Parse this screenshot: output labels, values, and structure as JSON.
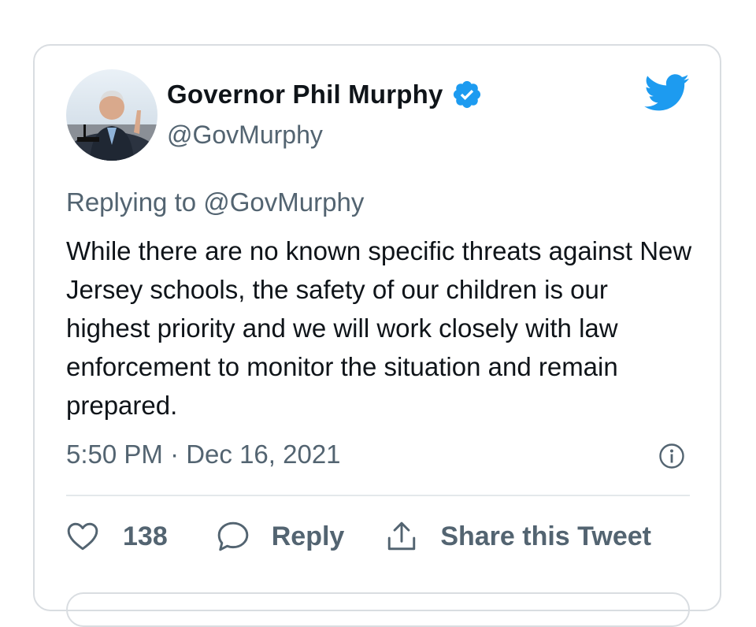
{
  "author": {
    "display_name": "Governor Phil Murphy",
    "handle": "@GovMurphy",
    "verified": true
  },
  "reply_context": {
    "prefix": "Replying to ",
    "mention": "@GovMurphy"
  },
  "tweet": {
    "text": "While there are no known specific threats against New Jersey schools, the safety of our children is our highest priority and we will work closely with law enforcement to monitor the situation and remain prepared.",
    "timestamp": "5:50 PM · Dec 16, 2021"
  },
  "actions": {
    "like_count": "138",
    "reply_label": "Reply",
    "share_label": "Share this Tweet"
  },
  "icons": {
    "verified": "verified-badge-icon",
    "brand": "twitter-bird-icon",
    "info": "info-icon",
    "like": "heart-icon",
    "reply": "speech-bubble-icon",
    "share": "share-arrow-icon"
  },
  "colors": {
    "brand_blue": "#1d9bf0",
    "text_primary": "#0f1419",
    "text_secondary": "#536471",
    "border": "#d9dde1"
  }
}
